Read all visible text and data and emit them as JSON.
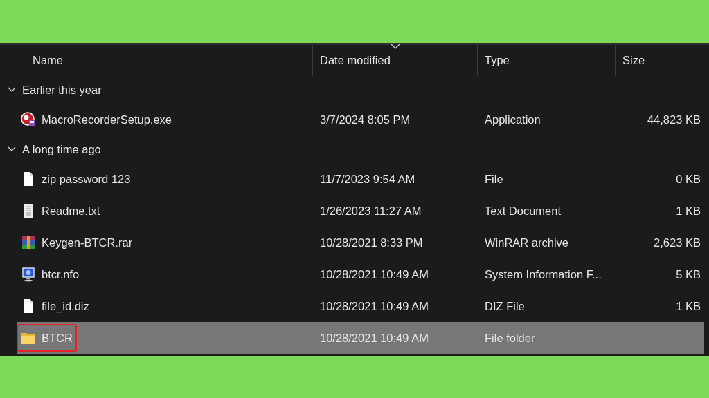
{
  "columns": [
    {
      "label": "Name",
      "sorted": false
    },
    {
      "label": "Date modified",
      "sorted": true
    },
    {
      "label": "Type",
      "sorted": false
    },
    {
      "label": "Size",
      "sorted": false
    }
  ],
  "groups": [
    {
      "label": "Earlier this year",
      "expanded": true,
      "files": [
        {
          "name": "MacroRecorderSetup.exe",
          "date": "3/7/2024 8:05 PM",
          "type": "Application",
          "size": "44,823 KB",
          "kind": "exe",
          "selected": false,
          "outlined": false
        }
      ]
    },
    {
      "label": "A long time ago",
      "expanded": true,
      "files": [
        {
          "name": "zip password 123",
          "date": "11/7/2023 9:54 AM",
          "type": "File",
          "size": "0 KB",
          "kind": "file",
          "selected": false,
          "outlined": false
        },
        {
          "name": "Readme.txt",
          "date": "1/26/2023 11:27 AM",
          "type": "Text Document",
          "size": "1 KB",
          "kind": "text",
          "selected": false,
          "outlined": false
        },
        {
          "name": "Keygen-BTCR.rar",
          "date": "10/28/2021 8:33 PM",
          "type": "WinRAR archive",
          "size": "2,623 KB",
          "kind": "archive",
          "selected": false,
          "outlined": false
        },
        {
          "name": "btcr.nfo",
          "date": "10/28/2021 10:49 AM",
          "type": "System Information F...",
          "size": "5 KB",
          "kind": "info",
          "selected": false,
          "outlined": false
        },
        {
          "name": "file_id.diz",
          "date": "10/28/2021 10:49 AM",
          "type": "DIZ File",
          "size": "1 KB",
          "kind": "file",
          "selected": false,
          "outlined": false
        },
        {
          "name": "BTCR",
          "date": "10/28/2021 10:49 AM",
          "type": "File folder",
          "kind": "folder",
          "selected": true,
          "outlined": true
        }
      ]
    }
  ]
}
